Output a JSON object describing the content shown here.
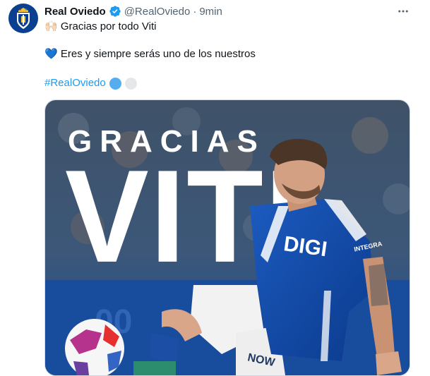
{
  "account": {
    "name": "Real Oviedo",
    "handle": "@RealOviedo",
    "separator": "·",
    "time": "9min"
  },
  "tweet": {
    "line1_emoji": "🙌🏻",
    "line1_text": "Gracias por todo Viti",
    "line2_emoji": "💙",
    "line2_text": "Eres y siempre serás uno de los nuestros",
    "hashtag": "#RealOviedo"
  },
  "media": {
    "overlay_word": "GRACIAS",
    "overlay_name": "VITI",
    "sponsor": "DIGI",
    "shorts_text": "NOW",
    "sleeve_brand": "INTEGRA"
  },
  "colors": {
    "accent": "#1d9bf0",
    "club_blue": "#0b3f8f",
    "text": "#0f1419",
    "muted": "#536471"
  },
  "icons": {
    "more": "more-horizontal-icon",
    "verified": "verified-badge-icon",
    "club_crest": "club-crest-icon"
  }
}
